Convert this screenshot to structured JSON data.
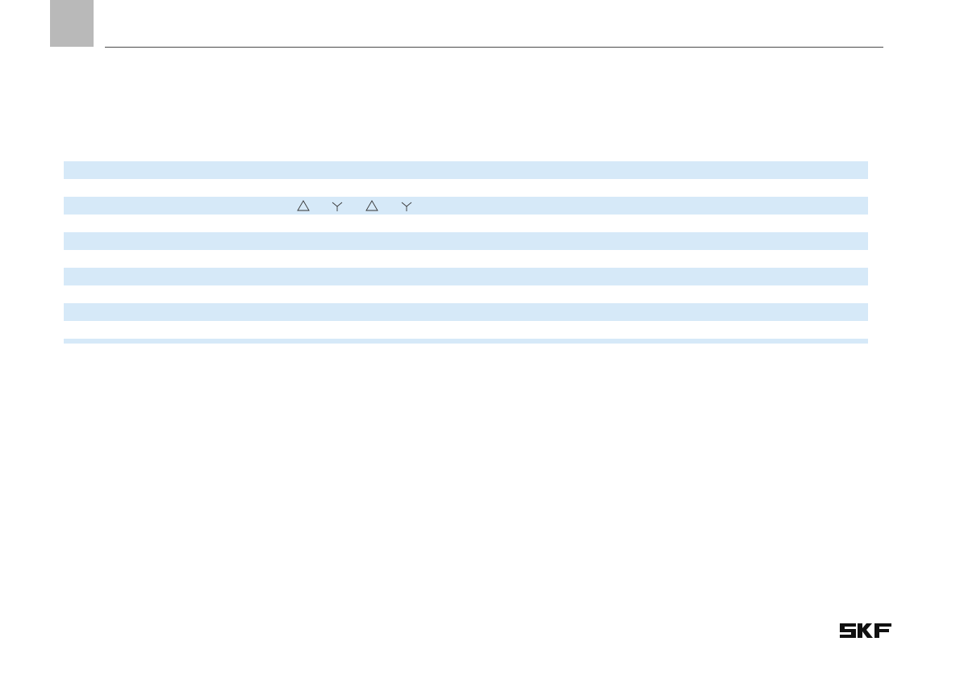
{
  "brand": {
    "logo_text": "SKF",
    "color": "#111111"
  },
  "colors": {
    "corner_tab": "#b9b9b9",
    "row_stripe": "#d6e9f8",
    "rule": "#4a4a4a"
  },
  "table": {
    "rows": 11,
    "wiring_symbols": [
      "delta-icon",
      "wye-icon",
      "delta-icon",
      "wye-icon"
    ]
  }
}
